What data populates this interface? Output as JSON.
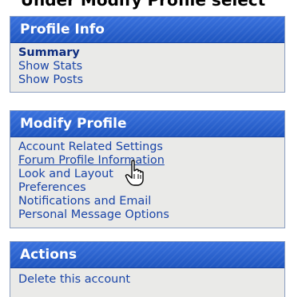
{
  "caption": "Under Modify Profile select",
  "panels": [
    {
      "title": "Profile Info",
      "items": [
        "Summary",
        "Show Stats",
        "Show Posts"
      ]
    },
    {
      "title": "Modify Profile",
      "items": [
        "Account Related Settings",
        "Forum Profile Information",
        "Look and Layout",
        "Preferences",
        "Notifications and Email",
        "Personal Message Options"
      ]
    },
    {
      "title": "Actions",
      "items": [
        "Delete this account"
      ]
    }
  ],
  "cursor": "hand-pointer-icon",
  "colors": {
    "header": "#2a60c8",
    "panel_bg": "#eaeae8",
    "link": "#1a45a8"
  }
}
